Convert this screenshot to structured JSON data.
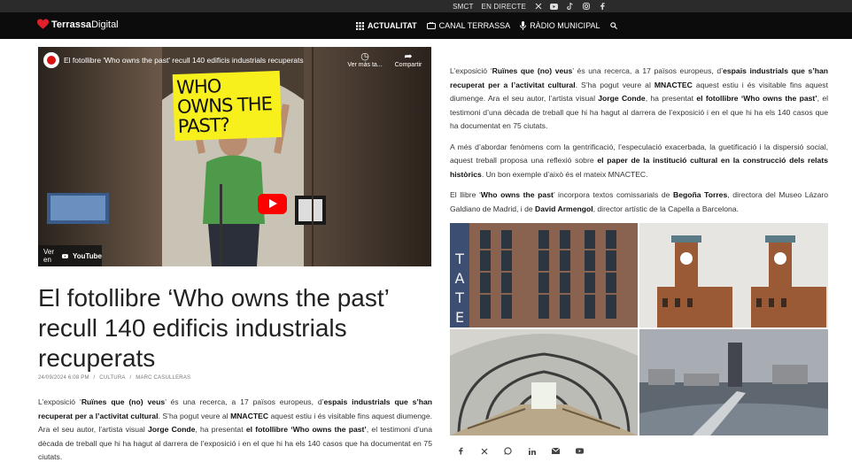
{
  "topbar": {
    "links": [
      "SMCT",
      "EN DIRECTE"
    ],
    "social_icons": [
      "x-icon",
      "youtube-icon",
      "tiktok-icon",
      "instagram-icon",
      "facebook-icon"
    ]
  },
  "nav": {
    "logo_bold": "Terrassa",
    "logo_light": "Digital",
    "items": [
      {
        "label": "ACTUALITAT",
        "icon": "grid-icon"
      },
      {
        "label": "CANAL TERRASSA",
        "icon": "tv-icon"
      },
      {
        "label": "RÀDIO MUNICIPAL",
        "icon": "mic-icon"
      }
    ],
    "search_icon": "search-icon"
  },
  "video": {
    "title": "El fotollibre 'Who owns the past' recull 140 edificis industrials recuperats",
    "watch_later": "Ver más ta...",
    "share": "Compartir",
    "watch_on": "Ver en",
    "youtube": "YouTube",
    "sign_text": "WHO OWNS THE PAST?"
  },
  "article": {
    "headline": "El fotollibre ‘Who owns the past’ recull 140 edificis industrials recuperats",
    "date": "24/09/2024 6:08 PM",
    "category": "CULTURA",
    "author": "MARC CASULLERAS",
    "separator": "/"
  },
  "paragraphs": {
    "p1": {
      "a": "L’exposició ‘",
      "b": "Ruïnes que (no) veus",
      "c": "’ és una recerca, a 17 països europeus, d’",
      "d": "espais industrials que s’han recuperat per a l’activitat cultural",
      "e": ". S’ha pogut veure al ",
      "f": "MNACTEC",
      "g": " aquest estiu i és visitable fins aquest diumenge. Ara el seu autor, l’artista visual ",
      "h": "Jorge Conde",
      "i": ", ha presentat ",
      "j": "el fotollibre ‘Who owns the past’",
      "k": ", el testimoni d’una dècada de treball que hi ha hagut al darrera de l’exposició i en el que hi ha els 140 casos que ha documentat en 75 ciutats."
    },
    "p2": {
      "a": "A més d’abordar fenòmens com la gentrificació, l’especulació exacerbada, la guetificació i la dispersió social, aquest treball proposa una reflexió sobre ",
      "b": "el paper de la institució cultural en la construcció dels relats històrics",
      "c": ". Un bon exemple d’això és el mateix MNACTEC."
    },
    "p3": {
      "a": "El llibre ‘",
      "b": "Who owns the past",
      "c": "’ incorpora textos comissarials de ",
      "d": "Begoña Torres",
      "e": ", directora del Museo Lázaro Galdiano de Madrid, i de ",
      "f": "David Armengol",
      "g": ", director artístic de la Capella a Barcelona."
    }
  },
  "collage": {
    "tate_letters": [
      "T",
      "A",
      "T",
      "E"
    ]
  },
  "share_icons": [
    "facebook-icon",
    "x-icon",
    "whatsapp-icon",
    "linkedin-icon",
    "email-icon",
    "youtube-icon"
  ]
}
